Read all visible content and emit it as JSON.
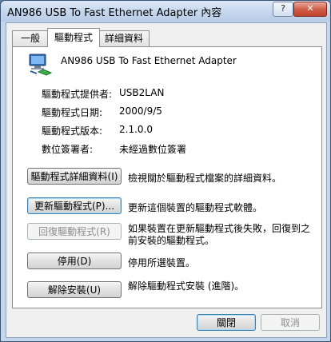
{
  "window": {
    "title": "AN986 USB To Fast Ethernet Adapter 內容",
    "help_label": "?",
    "close_label": "✕"
  },
  "tabs": [
    {
      "label": "一般"
    },
    {
      "label": "驅動程式"
    },
    {
      "label": "詳細資料"
    }
  ],
  "device": {
    "icon": "network-adapter-icon",
    "name": "AN986 USB To Fast Ethernet Adapter"
  },
  "info": [
    {
      "label": "驅動程式提供者:",
      "value": "USB2LAN"
    },
    {
      "label": "驅動程式日期:",
      "value": "2000/9/5"
    },
    {
      "label": "驅動程式版本:",
      "value": "2.1.0.0"
    },
    {
      "label": "數位簽署者:",
      "value": "未經過數位簽署"
    }
  ],
  "actions": [
    {
      "button": "驅動程式詳細資料(I)",
      "desc": "檢視關於驅動程式檔案的詳細資料。"
    },
    {
      "button": "更新驅動程式(P)...",
      "desc": "更新這個裝置的驅動程式軟體。"
    },
    {
      "button": "回復驅動程式(R)",
      "desc_line1": "如果裝置在更新驅動程式後失敗，回復到之",
      "desc_line2": "前安裝的驅動程式。"
    },
    {
      "button": "停用(D)",
      "desc": "停用所選裝置。"
    },
    {
      "button": "解除安裝(U)",
      "desc": "解除驅動程式安裝 (進階)。"
    }
  ],
  "footer": {
    "ok_label": "關閉",
    "cancel_label": "取消"
  }
}
